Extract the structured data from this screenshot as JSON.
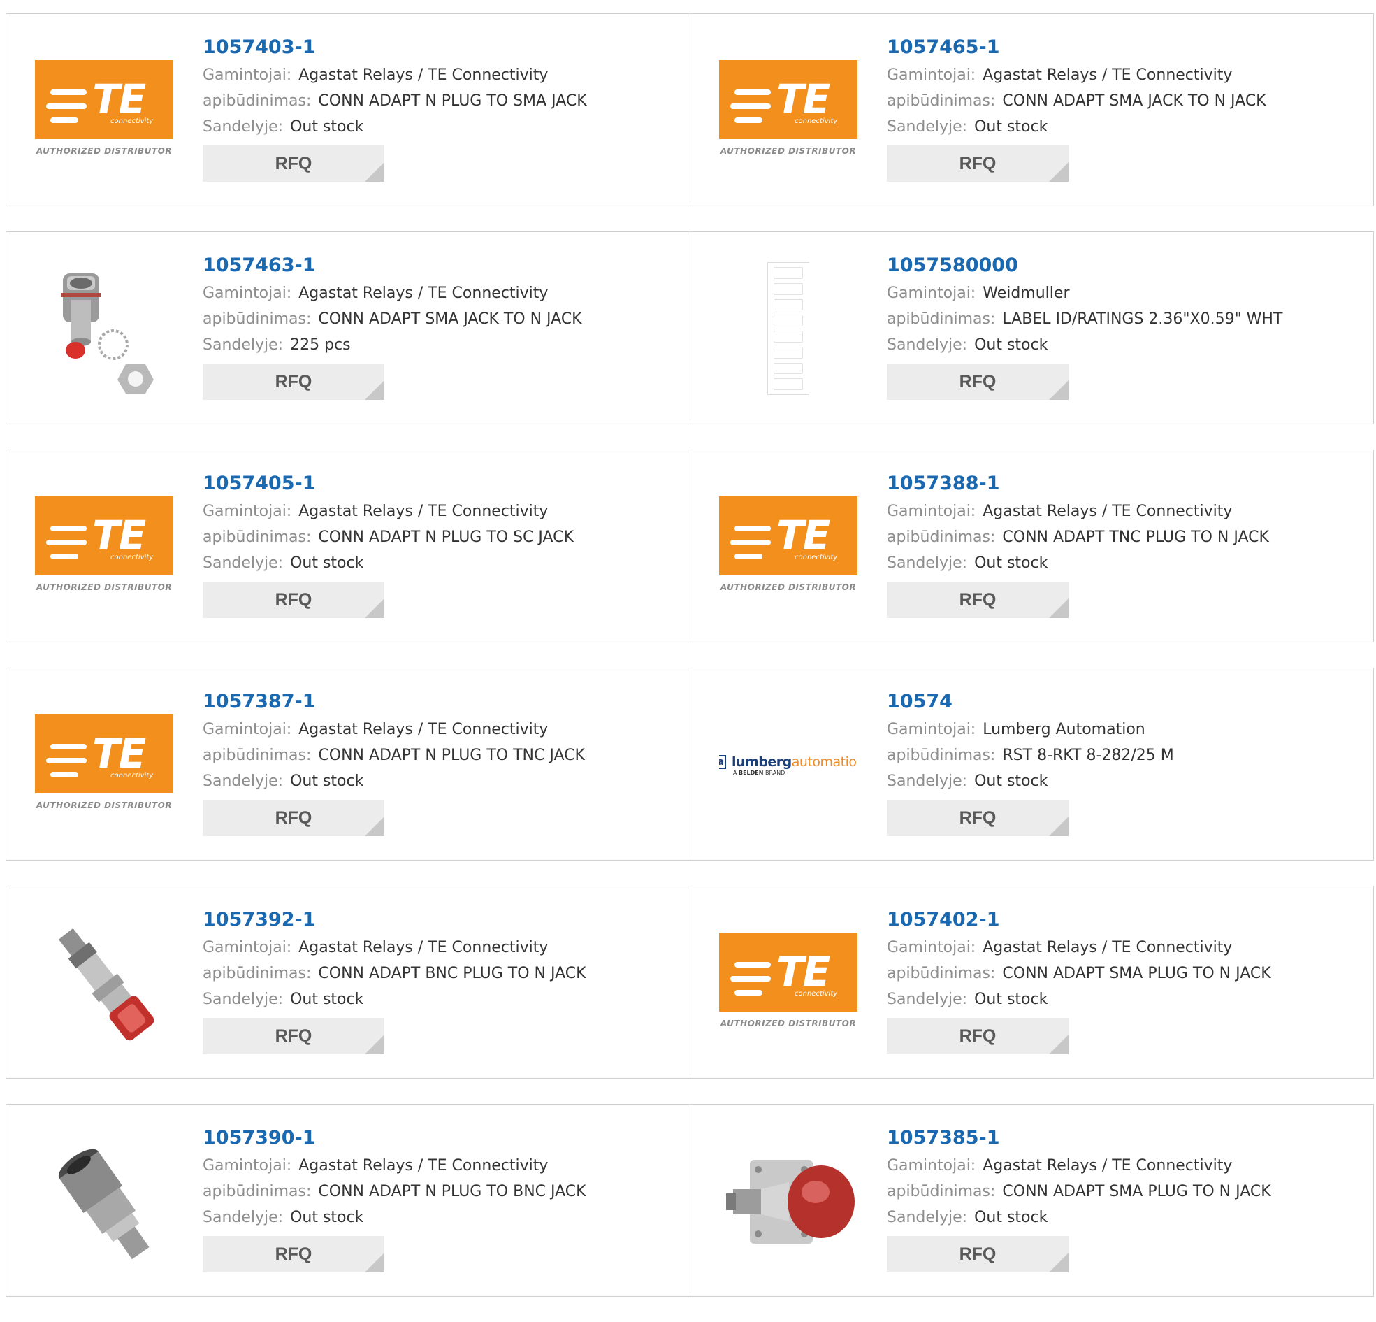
{
  "labels": {
    "manufacturer": "Gamintojai:",
    "description": "apibūdinimas:",
    "stock": "Sandelyje:",
    "rfq": "RFQ"
  },
  "logos": {
    "te_letters": "TE",
    "te_sub": "connectivity",
    "te_authorized": "AUTHORIZED DISTRIBUTOR",
    "lumberg_mark": "la",
    "lumberg_name_a": "lumberg",
    "lumberg_name_b": "automation",
    "lumberg_belden_a": "A",
    "lumberg_belden_b": "BELDEN",
    "lumberg_belden_c": "BRAND"
  },
  "colors": {
    "part_link": "#1a68b0",
    "te_orange": "#f3901d",
    "rfq_bg": "#ececec"
  },
  "products": [
    {
      "part": "1057403-1",
      "manufacturer": "Agastat Relays / TE Connectivity",
      "description": "CONN ADAPT N PLUG TO SMA JACK",
      "stock": "Out stock",
      "image": "te-logo"
    },
    {
      "part": "1057465-1",
      "manufacturer": "Agastat Relays / TE Connectivity",
      "description": "CONN ADAPT SMA JACK TO N JACK",
      "stock": "Out stock",
      "image": "te-logo"
    },
    {
      "part": "1057463-1",
      "manufacturer": "Agastat Relays / TE Connectivity",
      "description": "CONN ADAPT SMA JACK TO N JACK",
      "stock": "225 pcs",
      "image": "connector-photo"
    },
    {
      "part": "1057580000",
      "manufacturer": "Weidmuller",
      "description": "LABEL ID/RATINGS 2.36\"X0.59\" WHT",
      "stock": "Out stock",
      "image": "label-strip"
    },
    {
      "part": "1057405-1",
      "manufacturer": "Agastat Relays / TE Connectivity",
      "description": "CONN ADAPT N PLUG TO SC JACK",
      "stock": "Out stock",
      "image": "te-logo"
    },
    {
      "part": "1057388-1",
      "manufacturer": "Agastat Relays / TE Connectivity",
      "description": "CONN ADAPT TNC PLUG TO N JACK",
      "stock": "Out stock",
      "image": "te-logo"
    },
    {
      "part": "1057387-1",
      "manufacturer": "Agastat Relays / TE Connectivity",
      "description": "CONN ADAPT N PLUG TO TNC JACK",
      "stock": "Out stock",
      "image": "te-logo"
    },
    {
      "part": "10574",
      "manufacturer": "Lumberg Automation",
      "description": "RST 8-RKT 8-282/25 M",
      "stock": "Out stock",
      "image": "lumberg-logo"
    },
    {
      "part": "1057392-1",
      "manufacturer": "Agastat Relays / TE Connectivity",
      "description": "CONN ADAPT BNC PLUG TO N JACK",
      "stock": "Out stock",
      "image": "bnc-adapter-photo"
    },
    {
      "part": "1057402-1",
      "manufacturer": "Agastat Relays / TE Connectivity",
      "description": "CONN ADAPT SMA PLUG TO N JACK",
      "stock": "Out stock",
      "image": "te-logo"
    },
    {
      "part": "1057390-1",
      "manufacturer": "Agastat Relays / TE Connectivity",
      "description": "CONN ADAPT N PLUG TO BNC JACK",
      "stock": "Out stock",
      "image": "n-adapter-photo"
    },
    {
      "part": "1057385-1",
      "manufacturer": "Agastat Relays / TE Connectivity",
      "description": "CONN ADAPT SMA PLUG TO N JACK",
      "stock": "Out stock",
      "image": "flange-adapter-photo"
    }
  ]
}
